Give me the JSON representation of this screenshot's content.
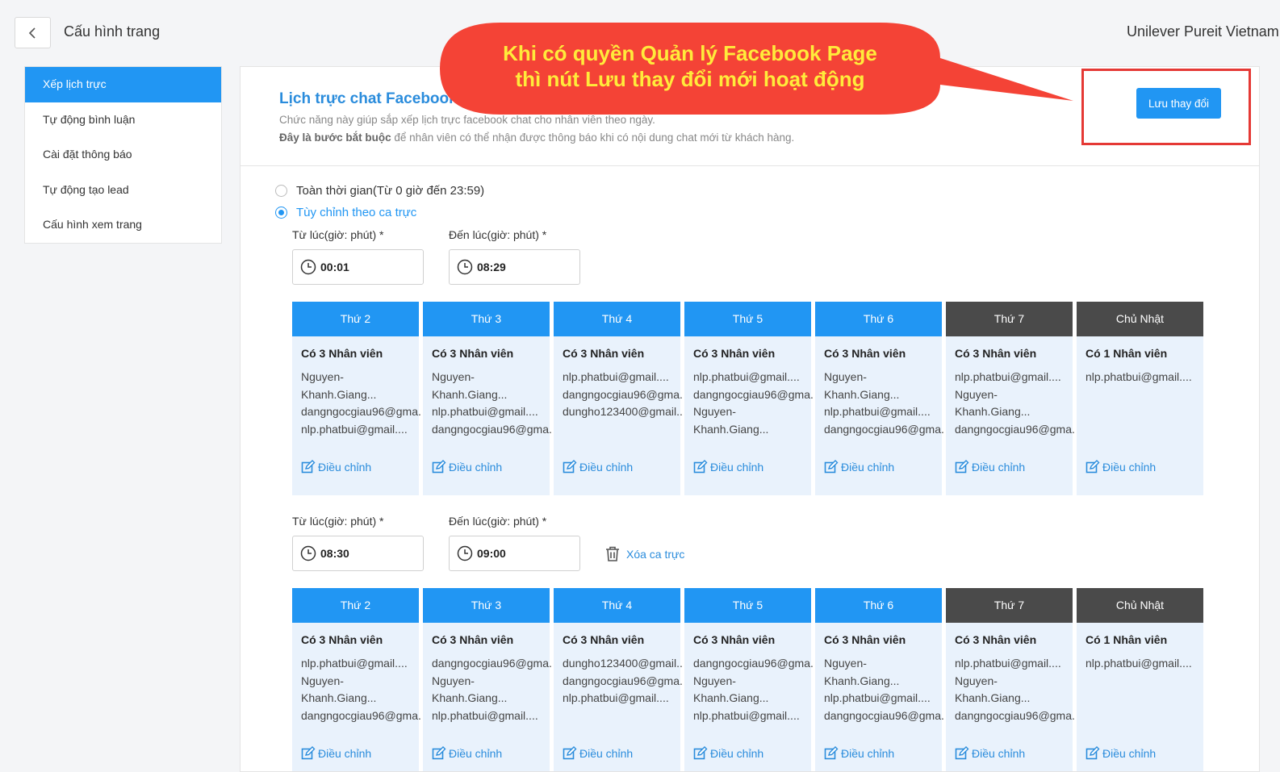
{
  "header": {
    "title": "Cấu hình trang",
    "org_name": "Unilever Pureit Vietnam"
  },
  "sidebar": {
    "items": [
      {
        "label": "Xếp lịch trực",
        "active": true
      },
      {
        "label": "Tự động bình luận",
        "active": false
      },
      {
        "label": "Cài đặt thông báo",
        "active": false
      },
      {
        "label": "Tự động tạo lead",
        "active": false
      },
      {
        "label": "Cấu hình xem trang",
        "active": false
      }
    ]
  },
  "section": {
    "title": "Lịch trực chat Facebook",
    "desc1": "Chức năng này giúp sắp xếp lịch trực facebook chat cho nhân viên theo ngày.",
    "desc2_bold": "Đây là bước bắt buộc",
    "desc2_rest": " để nhân viên có thể nhận được thông báo khi có nội dung chat mới từ khách hàng.",
    "save_label": "Lưu thay đổi"
  },
  "callout": {
    "line1": "Khi có quyền Quản lý Facebook Page",
    "line2": "thì nút Lưu thay đổi mới hoạt động",
    "color": "#f44336",
    "text_color": "#ffeb3b"
  },
  "mode": {
    "full_time": "Toàn thời gian(Từ 0 giờ đến 23:59)",
    "custom": "Tùy chỉnh theo ca trực",
    "selected": "custom"
  },
  "labels": {
    "from": "Từ lúc(giờ: phút) *",
    "to": "Đến lúc(giờ: phút) *",
    "delete_shift": "Xóa ca trực",
    "edit": "Điều chỉnh"
  },
  "shifts": [
    {
      "from": "00:01",
      "to": "08:29",
      "days": [
        {
          "name": "Thứ 2",
          "weekend": false,
          "count": "Có 3 Nhân viên",
          "staff": [
            "Nguyen-",
            "Khanh.Giang...",
            "dangngocgiau96@gma...",
            "nlp.phatbui@gmail...."
          ]
        },
        {
          "name": "Thứ 3",
          "weekend": false,
          "count": "Có 3 Nhân viên",
          "staff": [
            "Nguyen-",
            "Khanh.Giang...",
            "nlp.phatbui@gmail....",
            "dangngocgiau96@gma..."
          ]
        },
        {
          "name": "Thứ 4",
          "weekend": false,
          "count": "Có 3 Nhân viên",
          "staff": [
            "nlp.phatbui@gmail....",
            "dangngocgiau96@gma...",
            "dungho123400@gmail...."
          ]
        },
        {
          "name": "Thứ 5",
          "weekend": false,
          "count": "Có 3 Nhân viên",
          "staff": [
            "nlp.phatbui@gmail....",
            "dangngocgiau96@gma...",
            "Nguyen-",
            "Khanh.Giang..."
          ]
        },
        {
          "name": "Thứ 6",
          "weekend": false,
          "count": "Có 3 Nhân viên",
          "staff": [
            "Nguyen-",
            "Khanh.Giang...",
            "nlp.phatbui@gmail....",
            "dangngocgiau96@gma..."
          ]
        },
        {
          "name": "Thứ 7",
          "weekend": true,
          "count": "Có 3 Nhân viên",
          "staff": [
            "nlp.phatbui@gmail....",
            "Nguyen-",
            "Khanh.Giang...",
            "dangngocgiau96@gma..."
          ]
        },
        {
          "name": "Chủ Nhật",
          "weekend": true,
          "count": "Có 1 Nhân viên",
          "staff": [
            "nlp.phatbui@gmail...."
          ]
        }
      ]
    },
    {
      "from": "08:30",
      "to": "09:00",
      "days": [
        {
          "name": "Thứ 2",
          "weekend": false,
          "count": "Có 3 Nhân viên",
          "staff": [
            "nlp.phatbui@gmail....",
            "Nguyen-",
            "Khanh.Giang...",
            "dangngocgiau96@gma..."
          ]
        },
        {
          "name": "Thứ 3",
          "weekend": false,
          "count": "Có 3 Nhân viên",
          "staff": [
            "dangngocgiau96@gma...",
            "Nguyen-",
            "Khanh.Giang...",
            "nlp.phatbui@gmail...."
          ]
        },
        {
          "name": "Thứ 4",
          "weekend": false,
          "count": "Có 3 Nhân viên",
          "staff": [
            "dungho123400@gmail....",
            "dangngocgiau96@gma...",
            "nlp.phatbui@gmail...."
          ]
        },
        {
          "name": "Thứ 5",
          "weekend": false,
          "count": "Có 3 Nhân viên",
          "staff": [
            "dangngocgiau96@gma...",
            "Nguyen-",
            "Khanh.Giang...",
            "nlp.phatbui@gmail...."
          ]
        },
        {
          "name": "Thứ 6",
          "weekend": false,
          "count": "Có 3 Nhân viên",
          "staff": [
            "Nguyen-",
            "Khanh.Giang...",
            "nlp.phatbui@gmail....",
            "dangngocgiau96@gma..."
          ]
        },
        {
          "name": "Thứ 7",
          "weekend": true,
          "count": "Có 3 Nhân viên",
          "staff": [
            "nlp.phatbui@gmail....",
            "Nguyen-",
            "Khanh.Giang...",
            "dangngocgiau96@gma..."
          ]
        },
        {
          "name": "Chủ Nhật",
          "weekend": true,
          "count": "Có 1 Nhân viên",
          "staff": [
            "nlp.phatbui@gmail...."
          ]
        }
      ]
    }
  ]
}
